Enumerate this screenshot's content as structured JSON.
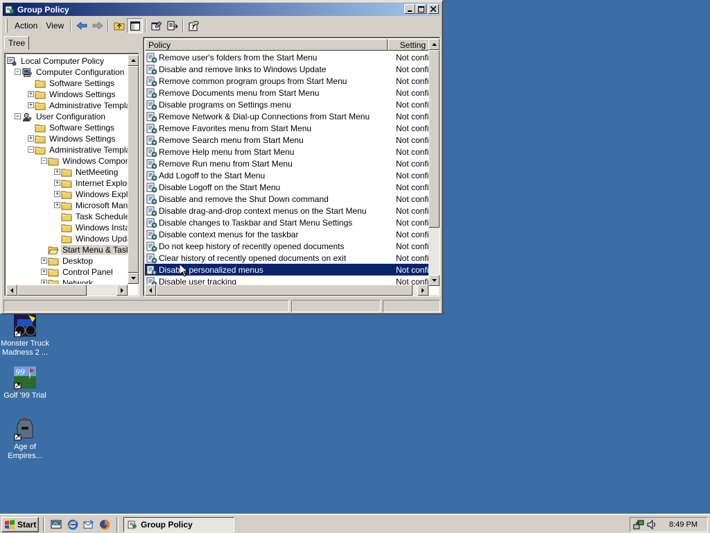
{
  "window": {
    "title": "Group Policy",
    "buttons": {
      "minimize": "_",
      "maximize": "□",
      "close": "×"
    }
  },
  "menubar": {
    "items": [
      {
        "label": "Action",
        "accel": "A"
      },
      {
        "label": "View",
        "accel": "V"
      }
    ],
    "toolbar": [
      "back-arrow-icon",
      "forward-arrow-icon",
      "up-one-level-icon",
      "show-hide-tree-icon",
      "properties-icon",
      "export-list-icon",
      "help-icon"
    ]
  },
  "tree": {
    "tab_label": "Tree",
    "items": [
      {
        "label": "Local Computer Policy",
        "level": 0,
        "expander": "",
        "icon": "policy-computer-icon"
      },
      {
        "label": "Computer Configuration",
        "level": 1,
        "expander": "−",
        "icon": "computer-icon"
      },
      {
        "label": "Software Settings",
        "level": 2,
        "expander": "",
        "icon": "folder-icon"
      },
      {
        "label": "Windows Settings",
        "level": 2,
        "expander": "+",
        "icon": "folder-icon"
      },
      {
        "label": "Administrative Templates",
        "level": 2,
        "expander": "+",
        "icon": "folder-icon"
      },
      {
        "label": "User Configuration",
        "level": 1,
        "expander": "−",
        "icon": "user-icon"
      },
      {
        "label": "Software Settings",
        "level": 2,
        "expander": "",
        "icon": "folder-icon"
      },
      {
        "label": "Windows Settings",
        "level": 2,
        "expander": "+",
        "icon": "folder-icon"
      },
      {
        "label": "Administrative Templates",
        "level": 2,
        "expander": "−",
        "icon": "folder-icon"
      },
      {
        "label": "Windows Components",
        "level": 3,
        "expander": "−",
        "icon": "folder-icon"
      },
      {
        "label": "NetMeeting",
        "level": 4,
        "expander": "+",
        "icon": "folder-icon"
      },
      {
        "label": "Internet Explorer",
        "level": 4,
        "expander": "+",
        "icon": "folder-icon"
      },
      {
        "label": "Windows Explorer",
        "level": 4,
        "expander": "+",
        "icon": "folder-icon"
      },
      {
        "label": "Microsoft Management Console",
        "level": 4,
        "expander": "+",
        "icon": "folder-icon"
      },
      {
        "label": "Task Scheduler",
        "level": 4,
        "expander": "",
        "icon": "folder-icon"
      },
      {
        "label": "Windows Installer",
        "level": 4,
        "expander": "",
        "icon": "folder-icon"
      },
      {
        "label": "Windows Update",
        "level": 4,
        "expander": "",
        "icon": "folder-icon"
      },
      {
        "label": "Start Menu & Taskbar",
        "level": 3,
        "expander": "",
        "icon": "folder-open-icon",
        "selected": true
      },
      {
        "label": "Desktop",
        "level": 3,
        "expander": "+",
        "icon": "folder-icon"
      },
      {
        "label": "Control Panel",
        "level": 3,
        "expander": "+",
        "icon": "folder-icon"
      },
      {
        "label": "Network",
        "level": 3,
        "expander": "+",
        "icon": "folder-icon"
      }
    ]
  },
  "list": {
    "columns": [
      "Policy",
      "Setting"
    ],
    "rows": [
      {
        "policy": "Remove user's folders from the Start Menu",
        "setting": "Not configured"
      },
      {
        "policy": "Disable and remove links to Windows Update",
        "setting": "Not configured"
      },
      {
        "policy": "Remove common program groups from Start Menu",
        "setting": "Not configured"
      },
      {
        "policy": "Remove Documents menu from Start Menu",
        "setting": "Not configured"
      },
      {
        "policy": "Disable programs on Settings menu",
        "setting": "Not configured"
      },
      {
        "policy": "Remove Network & Dial-up Connections from Start Menu",
        "setting": "Not configured"
      },
      {
        "policy": "Remove Favorites menu from Start Menu",
        "setting": "Not configured"
      },
      {
        "policy": "Remove Search menu from Start Menu",
        "setting": "Not configured"
      },
      {
        "policy": "Remove Help menu from Start Menu",
        "setting": "Not configured"
      },
      {
        "policy": "Remove Run menu from Start Menu",
        "setting": "Not configured"
      },
      {
        "policy": "Add Logoff to the Start Menu",
        "setting": "Not configured"
      },
      {
        "policy": "Disable Logoff on the Start Menu",
        "setting": "Not configured"
      },
      {
        "policy": "Disable and remove the Shut Down command",
        "setting": "Not configured"
      },
      {
        "policy": "Disable drag-and-drop context menus on the Start Menu",
        "setting": "Not configured"
      },
      {
        "policy": "Disable changes to Taskbar and Start Menu Settings",
        "setting": "Not configured"
      },
      {
        "policy": "Disable context menus for the taskbar",
        "setting": "Not configured"
      },
      {
        "policy": "Do not keep history of recently opened documents",
        "setting": "Not configured"
      },
      {
        "policy": "Clear history of recently opened documents on exit",
        "setting": "Not configured"
      },
      {
        "policy": "Disable personalized menus",
        "setting": "Not configured",
        "selected": true
      },
      {
        "policy": "Disable user tracking",
        "setting": "Not configured"
      }
    ]
  },
  "desktop": {
    "icons": [
      {
        "label": "Monster Truck Madness 2 ...",
        "icon": "monster-truck-icon"
      },
      {
        "label": "Golf '99 Trial",
        "icon": "golf-icon"
      },
      {
        "label": "Age of Empires...",
        "icon": "age-of-empires-icon"
      }
    ]
  },
  "taskbar": {
    "start_label": "Start",
    "quick_launch": [
      "show-desktop-icon",
      "internet-explorer-icon",
      "outlook-express-icon",
      "firefox-icon"
    ],
    "task_button_label": "Group Policy",
    "clock": "8:49 PM"
  },
  "colors": {
    "desktop": "#3a6ea5",
    "selection": "#0a246a",
    "title_gradient_start": "#0a246a",
    "title_gradient_end": "#a6caf0",
    "chrome": "#d4d0c8"
  }
}
